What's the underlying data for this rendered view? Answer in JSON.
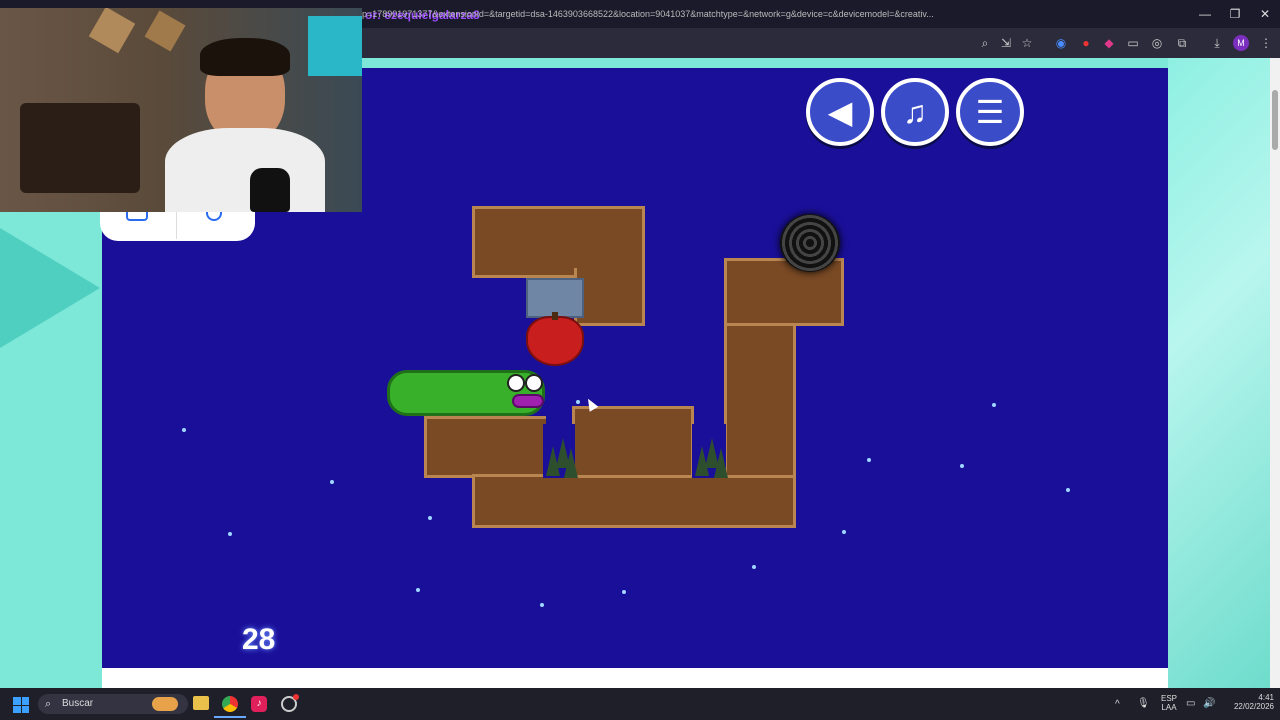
{
  "window": {
    "stream_user": "or: ezequielgalarza8",
    "url": "p=178901971377&extensionid=&targetid=dsa-1463903668522&location=9041037&matchtype=&network=g&device=c&devicemodel=&creativ..."
  },
  "game": {
    "level_number": "28",
    "buttons": [
      "sound",
      "music",
      "menu"
    ]
  },
  "taskbar": {
    "search_label": "Buscar",
    "lang_top": "ESP",
    "lang_bottom": "LAA",
    "time": "4:41",
    "date": "22/02/2026"
  },
  "colors": {
    "sky": "#1a0f99",
    "dirt": "#7a4a25",
    "worm": "#38b02a",
    "apple": "#c81e1e"
  }
}
